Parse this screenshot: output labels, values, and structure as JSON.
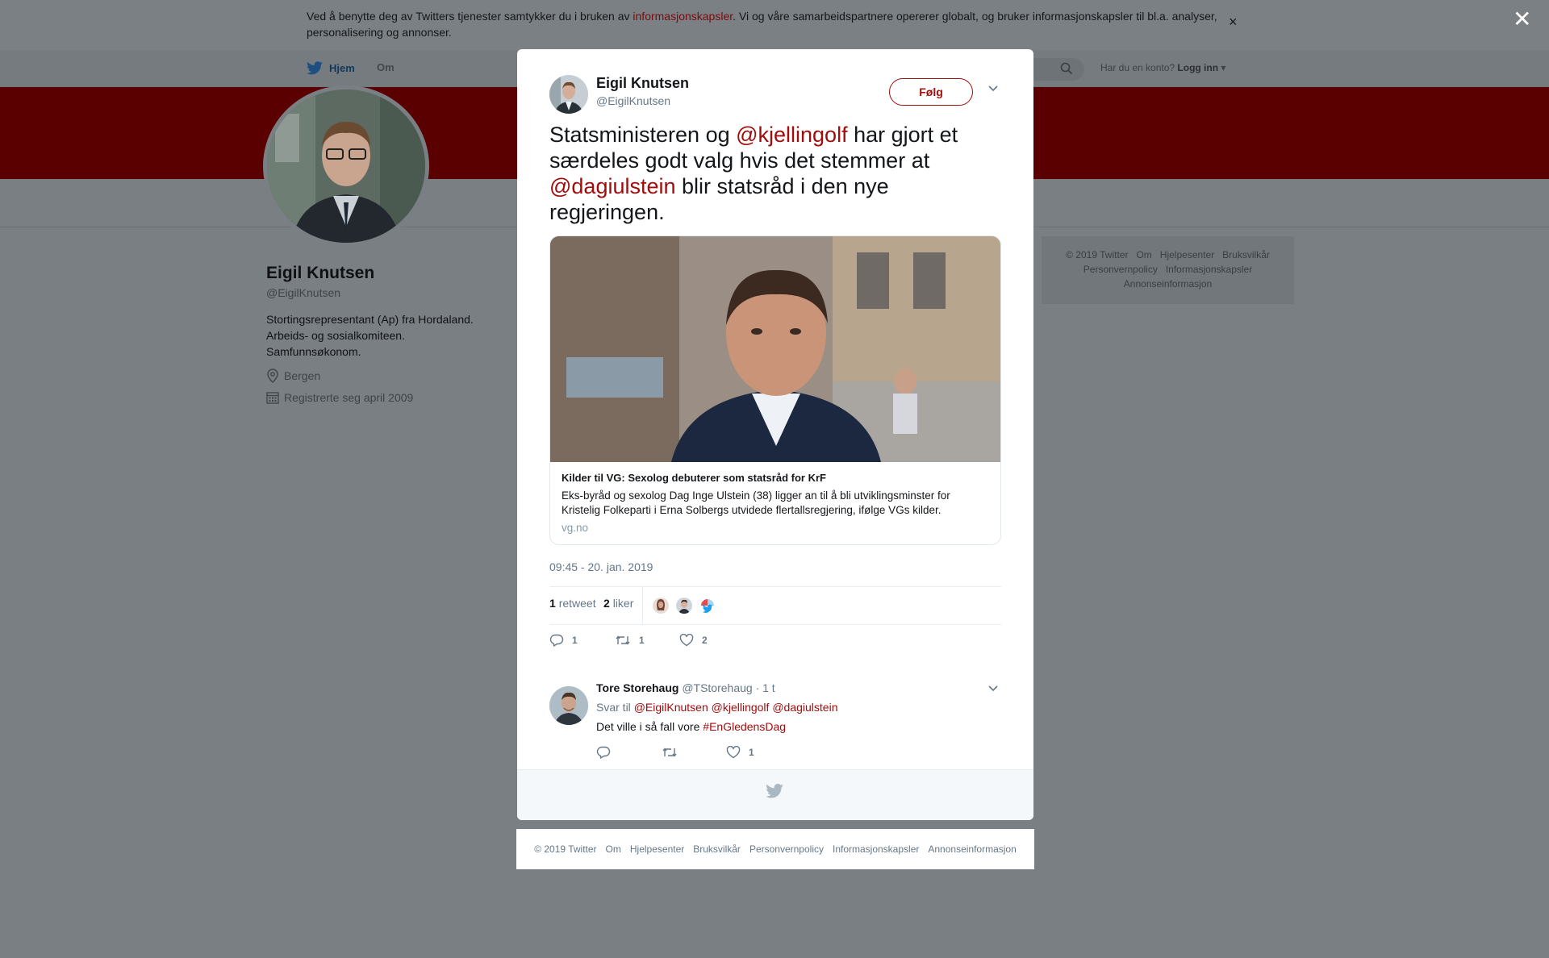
{
  "cookie_banner": {
    "text_before": "Ved å benytte deg av Twitters tjenester samtykker du i bruken av ",
    "link": "informasjonskapsler",
    "text_after": ". Vi og våre samarbeidspartnere opererer globalt, og bruker informasjonskapsler til bl.a. analyser, personalisering og annonser.",
    "close_label": "×"
  },
  "overlay_close_label": "✕",
  "topnav": {
    "home_label": "Hjem",
    "about_label": "Om",
    "account_prompt": "Har du en konto?",
    "login_label": "Logg inn"
  },
  "profile": {
    "name": "Eigil Knutsen",
    "handle": "@EigilKnutsen",
    "bio": [
      "Stortingsrepresentant (Ap) fra Hordaland.",
      "Arbeids- og sosialkomiteen.",
      "Samfunnsøkonom."
    ],
    "location": "Bergen",
    "joined": "Registrerte seg april 2009"
  },
  "side_footer": {
    "line1": [
      "© 2019 Twitter",
      "Om",
      "Hjelpesenter",
      "Bruksvilkår"
    ],
    "line2": [
      "Personvernpolicy",
      "Informasjonskapsler"
    ],
    "line3": [
      "Annonseinformasjon"
    ]
  },
  "bottom_footer": [
    "© 2019 Twitter",
    "Om",
    "Hjelpesenter",
    "Bruksvilkår",
    "Personvernpolicy",
    "Informasjonskapsler",
    "Annonseinformasjon"
  ],
  "tweet": {
    "author_name": "Eigil Knutsen",
    "author_handle": "@EigilKnutsen",
    "follow_label": "Følg",
    "text_parts": {
      "p1": "Statsministeren og ",
      "m1": "@kjellingolf",
      "p2": " har gjort et særdeles godt valg hvis det stemmer at ",
      "m2": "@dagiulstein",
      "p3": " blir statsråd i den nye regjeringen."
    },
    "card": {
      "title": "Kilder til VG: Sexolog debuterer som statsråd for KrF",
      "description": "Eks-byråd og sexolog Dag Inge Ulstein (38) ligger an til å bli utviklingsminster for Kristelig Folkeparti i Erna Solbergs utvidede flertallsregjering, ifølge VGs kilder.",
      "domain": "vg.no"
    },
    "timestamp": "09:45 - 20. jan. 2019",
    "retweets_count": "1",
    "retweets_label": "retweet",
    "likes_count": "2",
    "likes_label": "liker",
    "actions": {
      "reply_count": "1",
      "retweet_count": "1",
      "like_count": "2"
    }
  },
  "reply": {
    "name": "Tore Storehaug",
    "handle": "@TStorehaug",
    "time": "· 1 t",
    "reply_prefix": "Svar til ",
    "reply_mentions": [
      "@EigilKnutsen",
      "@kjellingolf",
      "@dagiulstein"
    ],
    "text": "Det ville i så fall vore ",
    "hashtag": "#EnGledensDag",
    "like_count": "1"
  },
  "colors": {
    "accent": "#a10c0c",
    "banner": "#5a0000",
    "overlay": "#7a7f84",
    "secondary_text": "#657786"
  },
  "icons": [
    "twitter-bird-icon",
    "search-icon",
    "location-pin-icon",
    "calendar-icon",
    "chevron-down-icon",
    "reply-icon",
    "retweet-icon",
    "heart-icon",
    "close-icon"
  ]
}
